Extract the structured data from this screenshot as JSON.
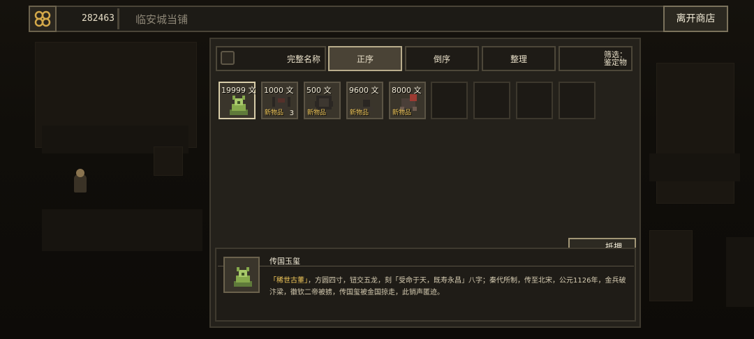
{
  "header": {
    "money": "282463",
    "shop_name": "临安城当铺",
    "leave_button": "离开商店",
    "coin_icon": "coin-cluster-icon"
  },
  "toolbar": {
    "full_name_label": "完整名称",
    "asc_label": "正序",
    "desc_label": "倒序",
    "sort_label": "整理",
    "filter_line1": "筛选：",
    "filter_line2": "鉴定物"
  },
  "items": [
    {
      "price": "19999 文",
      "new": "",
      "qty": "",
      "icon": "jade-seal-icon",
      "selected": true
    },
    {
      "price": "1000 文",
      "new": "新物品",
      "qty": "3",
      "icon": "dark-armor-icon",
      "selected": false
    },
    {
      "price": "500 文",
      "new": "新物品",
      "qty": "",
      "icon": "dark-cloth-icon",
      "selected": false
    },
    {
      "price": "9600 文",
      "new": "新物品",
      "qty": "",
      "icon": "dark-trinket-icon",
      "selected": false
    },
    {
      "price": "8000 文",
      "new": "新物品",
      "qty": "",
      "icon": "red-beast-icon",
      "selected": false
    }
  ],
  "empty_slots": 4,
  "actions": {
    "pawn_button": "抵押"
  },
  "detail": {
    "name": "传国玉玺",
    "tag": "「稀世古董」",
    "description": "，方圆四寸，钮交五龙，刻「受命于天，既寿永昌」八字；秦代所制，传至北宋，公元1126年，金兵破汴梁，徽钦二帝被掳，传国玺被金国掠走，此销声匿迹。"
  },
  "colors": {
    "accent_gold": "#f3c95a",
    "panel_bg": "#24211b",
    "selected_border": "#d8cda9"
  }
}
